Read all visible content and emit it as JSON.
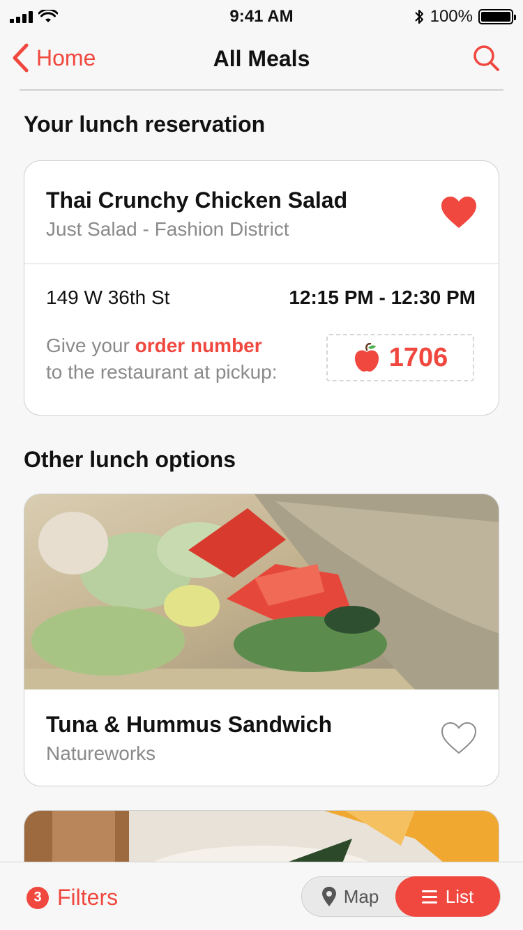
{
  "status_bar": {
    "time": "9:41 AM",
    "battery": "100%",
    "battery_level": 1.0
  },
  "nav": {
    "back_label": "Home",
    "title": "All Meals"
  },
  "reservation": {
    "section_title": "Your lunch reservation",
    "meal_name": "Thai Crunchy Chicken Salad",
    "restaurant": "Just Salad - Fashion District",
    "favorited": true,
    "address": "149 W 36th St",
    "time_window": "12:15 PM - 12:30 PM",
    "instruction_prefix": "Give your ",
    "instruction_highlight": "order number",
    "instruction_suffix": "to the restaurant at pickup:",
    "order_number": "1706"
  },
  "options": {
    "section_title": "Other lunch options",
    "items": [
      {
        "meal_name": "Tuna & Hummus Sandwich",
        "restaurant": "Natureworks",
        "favorited": false
      }
    ]
  },
  "bottom_bar": {
    "filter_count": "3",
    "filters_label": "Filters",
    "map_label": "Map",
    "list_label": "List",
    "selected": "List"
  },
  "colors": {
    "accent": "#f0473e",
    "secondary_text": "#8a8a8a",
    "background": "#f7f7f7"
  }
}
